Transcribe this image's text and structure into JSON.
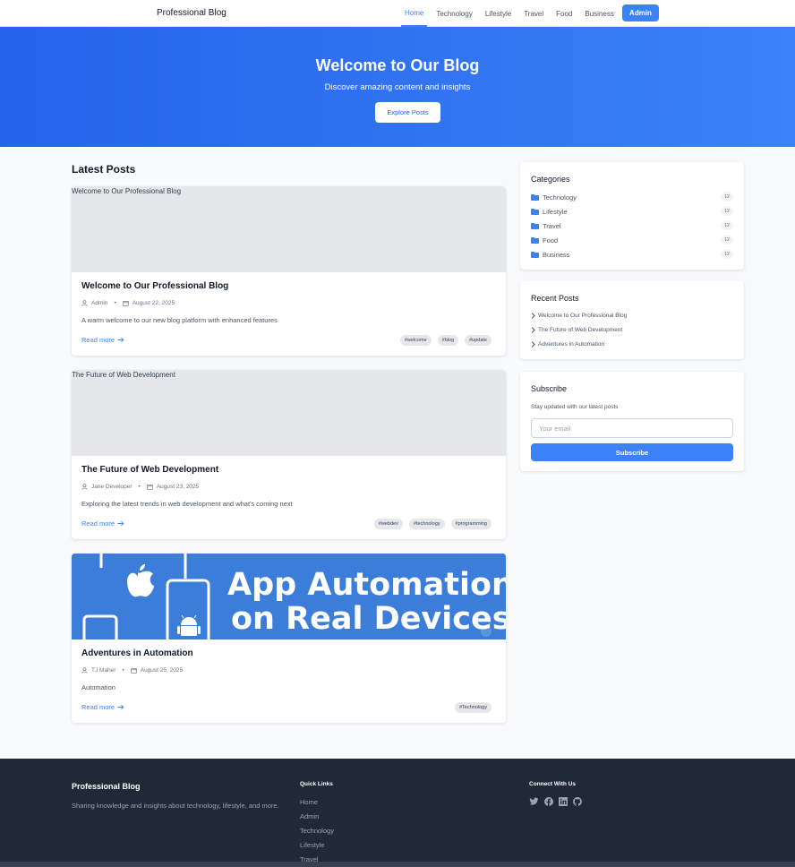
{
  "nav": {
    "brand": "Professional Blog",
    "links": [
      "Home",
      "Technology",
      "Lifestyle",
      "Travel",
      "Food",
      "Business"
    ],
    "admin": "Admin"
  },
  "hero": {
    "title": "Welcome to Our Blog",
    "subtitle": "Discover amazing content and insights",
    "button": "Explore Posts"
  },
  "main": {
    "section_title": "Latest Posts",
    "posts": [
      {
        "image_alt": "Welcome to Our Professional Blog",
        "title": "Welcome to Our Professional Blog",
        "author": "Admin",
        "date": "August 22, 2025",
        "excerpt": "A warm welcome to our new blog platform with enhanced features",
        "read_more": "Read more",
        "tags": [
          "#welcome",
          "#blog",
          "#update"
        ]
      },
      {
        "image_alt": "The Future of Web Development",
        "title": "The Future of Web Development",
        "author": "Jane Developer",
        "date": "August 23, 2025",
        "excerpt": "Exploring the latest trends in web development and what's coming next",
        "read_more": "Read more",
        "tags": [
          "#webdev",
          "#technology",
          "#programming"
        ]
      },
      {
        "image_text_line1": "App Automation",
        "image_text_line2": "on Real Devices",
        "title": "Adventures in Automation",
        "author": "TJ Maher",
        "date": "August 25, 2025",
        "excerpt": "Automation",
        "read_more": "Read more",
        "tags": [
          "#Technology"
        ]
      }
    ]
  },
  "sidebar": {
    "categories": {
      "title": "Categories",
      "items": [
        {
          "label": "Technology",
          "count": "12"
        },
        {
          "label": "Lifestyle",
          "count": "12"
        },
        {
          "label": "Travel",
          "count": "12"
        },
        {
          "label": "Food",
          "count": "12"
        },
        {
          "label": "Business",
          "count": "12"
        }
      ]
    },
    "recent": {
      "title": "Recent Posts",
      "items": [
        "Welcome to Our Professional Blog",
        "The Future of Web Development",
        "Adventures in Automation"
      ]
    },
    "subscribe": {
      "title": "Subscribe",
      "text": "Stay updated with our latest posts",
      "placeholder": "Your email",
      "button": "Subscribe"
    }
  },
  "footer": {
    "brand": "Professional Blog",
    "description": "Sharing knowledge and insights about technology, lifestyle, and more.",
    "quick_links_title": "Quick Links",
    "quick_links": [
      "Home",
      "Admin",
      "Technology",
      "Lifestyle",
      "Travel"
    ],
    "connect_title": "Connect With Us",
    "social_icons": [
      "twitter-icon",
      "facebook-icon",
      "linkedin-icon",
      "github-icon"
    ]
  },
  "colors": {
    "accent": "#3b82f6",
    "hero_start": "#2563eb",
    "footer_bg": "#1f2937"
  }
}
